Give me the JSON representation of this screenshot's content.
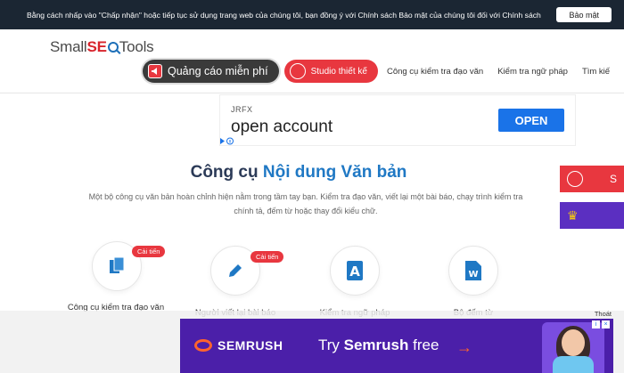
{
  "cookie": {
    "text": "Bằng cách nhấp vào \"Chấp nhận\" hoặc tiếp tục sử dụng trang web của chúng tôi, bạn đồng ý với Chính sách Bảo mật của chúng tôi đối với Chính sách",
    "button": "Bảo mật"
  },
  "logo": {
    "part1": "Small",
    "part2": "SE",
    "part3": "Tools"
  },
  "nav": {
    "ads": "Quảng cáo miễn phí",
    "studio": "Studio thiết kế",
    "links": [
      "Công cụ kiểm tra đạo văn",
      "Kiểm tra ngữ pháp",
      "Tìm kiế"
    ]
  },
  "ad": {
    "brand": "JRFX",
    "headline": "open account",
    "button": "OPEN"
  },
  "main": {
    "title_prefix": "Công cụ ",
    "title_highlight": "Nội dung Văn bản",
    "description": "Một bộ công cụ văn bản hoàn chỉnh hiện nằm trong tầm tay bạn. Kiểm tra đạo văn, viết lại một bài báo, chạy trình kiểm tra chính tả, đếm từ hoặc thay đổi kiểu chữ."
  },
  "side": {
    "red_label": "S",
    "purple_label": "♛"
  },
  "tools": [
    {
      "label": "Công cụ kiểm tra đạo văn",
      "badge": "Cải tiến"
    },
    {
      "label": "Người viết lại bài báo",
      "badge": "Cải tiến"
    },
    {
      "label": "Kiểm tra ngữ pháp",
      "badge": ""
    },
    {
      "label": "Bộ đếm từ",
      "badge": ""
    }
  ],
  "bottom_ad": {
    "close_label": "Thoát",
    "brand": "SEMRUSH",
    "cta_prefix": "Try ",
    "cta_bold": "Semrush",
    "cta_suffix": " free",
    "arrow": "→"
  },
  "colors": {
    "accent_red": "#e8373f",
    "accent_blue": "#1f78c4",
    "semrush_purple": "#4b1fa9"
  }
}
